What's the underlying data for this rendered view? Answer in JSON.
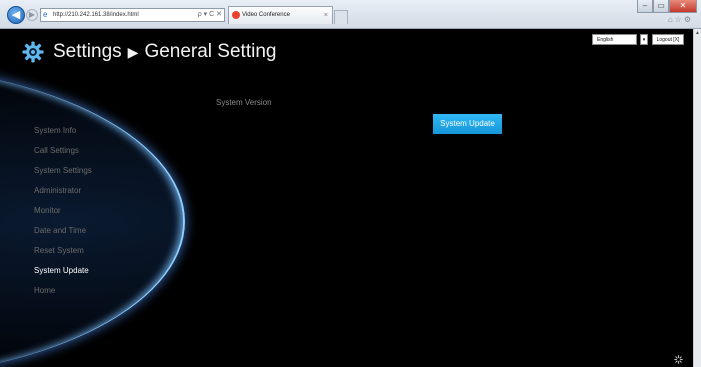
{
  "browser": {
    "address_url": "http://210.242.161.38/index.html",
    "address_controls": "ρ ▾ C ✕",
    "tab_title": "Video Conference",
    "tab_close": "×",
    "back_icon": "back-arrow-icon",
    "forward_icon": "forward-arrow-icon",
    "window_controls": {
      "minimize": "–",
      "maximize": "▭",
      "close": "✕"
    },
    "toolbar_icons": "⌂☆⚙"
  },
  "page": {
    "section": "Settings",
    "separator": "▶",
    "subsection": "General Setting",
    "header_icon": "gear-icon",
    "language": {
      "selected": "English",
      "arrow": "▾"
    },
    "logout_label": "Logout [X]",
    "system_version_label": "System Version",
    "update_button_label": "System Update",
    "accent_color": "#1ea5e8"
  },
  "sidebar": {
    "items": [
      {
        "label": "System Info"
      },
      {
        "label": "Call Settings"
      },
      {
        "label": "System Settings"
      },
      {
        "label": "Administrator"
      },
      {
        "label": "Monitor"
      },
      {
        "label": "Date and Time"
      },
      {
        "label": "Reset System"
      },
      {
        "label": "System Update",
        "active": true
      },
      {
        "label": "Home"
      }
    ]
  }
}
